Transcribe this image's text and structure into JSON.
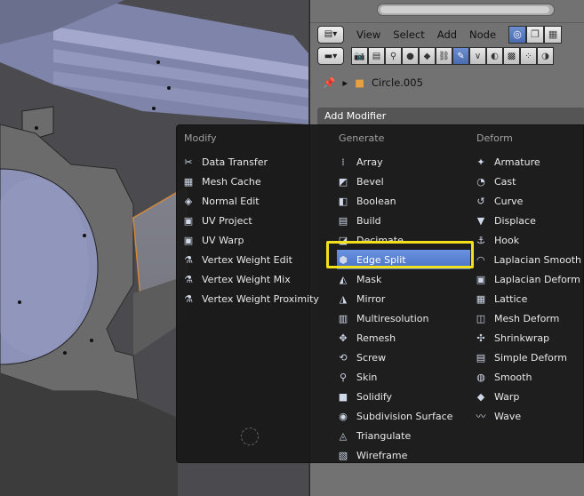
{
  "header": {
    "menus": [
      "View",
      "Select",
      "Add",
      "Node"
    ]
  },
  "context_bar": {
    "icons": [
      "render-icon",
      "render-layers-icon",
      "scene-icon",
      "world-icon",
      "object-icon",
      "constraints-icon",
      "modifiers-icon",
      "data-icon",
      "material-icon",
      "texture-icon",
      "particles-icon",
      "physics-icon"
    ]
  },
  "breadcrumb": {
    "object_name": "Circle.005"
  },
  "panel": {
    "title": "Add Modifier"
  },
  "menu": {
    "columns": [
      {
        "title": "Modify",
        "items": [
          {
            "label": "Data Transfer",
            "icon": "data-transfer-icon"
          },
          {
            "label": "Mesh Cache",
            "icon": "mesh-cache-icon"
          },
          {
            "label": "Normal Edit",
            "icon": "normal-edit-icon"
          },
          {
            "label": "UV Project",
            "icon": "uv-project-icon"
          },
          {
            "label": "UV Warp",
            "icon": "uv-warp-icon"
          },
          {
            "label": "Vertex Weight Edit",
            "icon": "vertex-weight-icon"
          },
          {
            "label": "Vertex Weight Mix",
            "icon": "vertex-weight-icon"
          },
          {
            "label": "Vertex Weight Proximity",
            "icon": "vertex-weight-icon"
          }
        ]
      },
      {
        "title": "Generate",
        "items": [
          {
            "label": "Array",
            "icon": "array-icon"
          },
          {
            "label": "Bevel",
            "icon": "bevel-icon"
          },
          {
            "label": "Boolean",
            "icon": "boolean-icon"
          },
          {
            "label": "Build",
            "icon": "build-icon"
          },
          {
            "label": "Decimate",
            "icon": "decimate-icon"
          },
          {
            "label": "Edge Split",
            "icon": "edge-split-icon",
            "highlighted": true
          },
          {
            "label": "Mask",
            "icon": "mask-icon"
          },
          {
            "label": "Mirror",
            "icon": "mirror-icon"
          },
          {
            "label": "Multiresolution",
            "icon": "multiresolution-icon"
          },
          {
            "label": "Remesh",
            "icon": "remesh-icon"
          },
          {
            "label": "Screw",
            "icon": "screw-icon"
          },
          {
            "label": "Skin",
            "icon": "skin-icon"
          },
          {
            "label": "Solidify",
            "icon": "solidify-icon"
          },
          {
            "label": "Subdivision Surface",
            "icon": "subsurf-icon"
          },
          {
            "label": "Triangulate",
            "icon": "triangulate-icon"
          },
          {
            "label": "Wireframe",
            "icon": "wireframe-icon"
          }
        ]
      },
      {
        "title": "Deform",
        "items": [
          {
            "label": "Armature",
            "icon": "armature-icon"
          },
          {
            "label": "Cast",
            "icon": "cast-icon"
          },
          {
            "label": "Curve",
            "icon": "curve-icon"
          },
          {
            "label": "Displace",
            "icon": "displace-icon"
          },
          {
            "label": "Hook",
            "icon": "hook-icon"
          },
          {
            "label": "Laplacian Smooth",
            "icon": "laplacian-smooth-icon"
          },
          {
            "label": "Laplacian Deform",
            "icon": "laplacian-deform-icon"
          },
          {
            "label": "Lattice",
            "icon": "lattice-icon"
          },
          {
            "label": "Mesh Deform",
            "icon": "mesh-deform-icon"
          },
          {
            "label": "Shrinkwrap",
            "icon": "shrinkwrap-icon"
          },
          {
            "label": "Simple Deform",
            "icon": "simple-deform-icon"
          },
          {
            "label": "Smooth",
            "icon": "smooth-icon"
          },
          {
            "label": "Warp",
            "icon": "warp-icon"
          },
          {
            "label": "Wave",
            "icon": "wave-icon"
          }
        ]
      }
    ]
  },
  "colors": {
    "highlight": "#5680d6",
    "highlight_frame": "#f2e11a",
    "menu_bg": "#181818"
  }
}
